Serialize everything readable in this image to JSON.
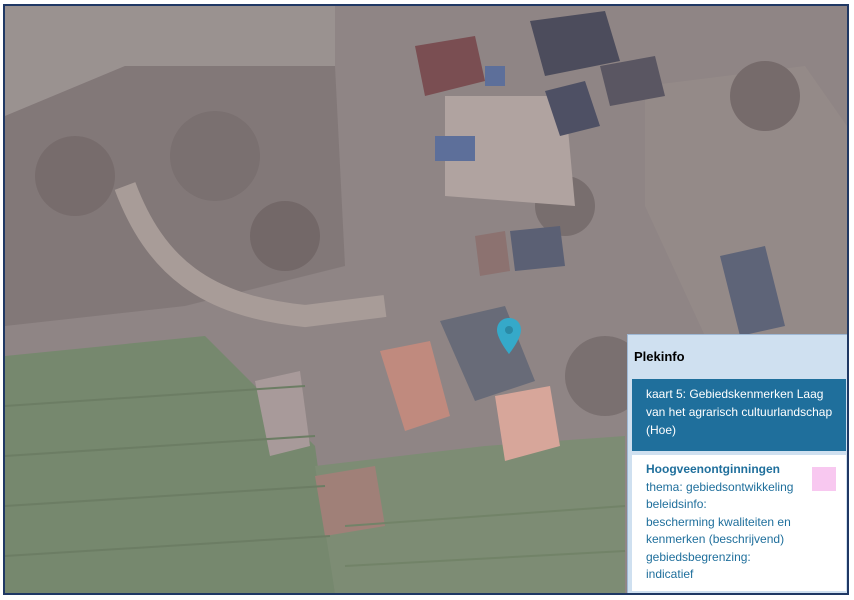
{
  "map": {
    "marker_icon": "map-pin-icon",
    "marker_color": "#35a9c9"
  },
  "plekinfo": {
    "title": "Plekinfo",
    "layer": {
      "title": "kaart 5: Gebiedskenmerken Laag van het agrarisch cultuurlandschap (Hoe)",
      "color": "#1f6f9c"
    },
    "feature": {
      "name": "Hoogveenontginningen",
      "swatch_color": "#f8c8f0",
      "lines": [
        "thema: gebiedsontwikkeling",
        "beleidsinfo:",
        "bescherming kwaliteiten en",
        "kenmerken (beschrijvend)",
        "gebiedsbegrenzing:",
        "indicatief"
      ]
    }
  }
}
